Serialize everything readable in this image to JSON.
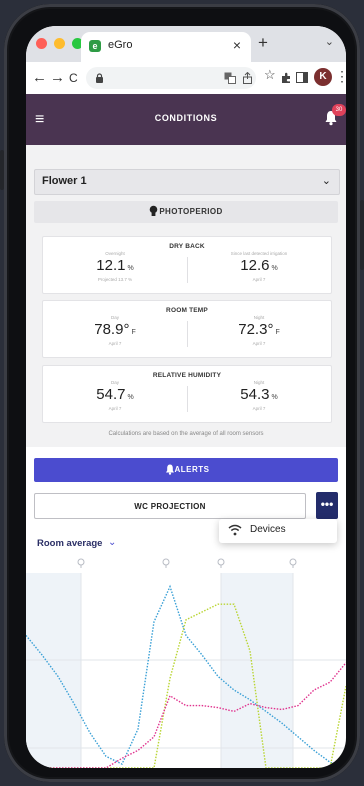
{
  "browser": {
    "tab_title": "eGro",
    "tab_favicon_letter": "e",
    "close_glyph": "×",
    "new_tab_glyph": "+",
    "tab_menu_glyph": "⌄",
    "back_glyph": "←",
    "forward_glyph": "→",
    "reload_glyph": "C",
    "profile_initial": "K",
    "menu_glyph": "⋮",
    "traffic_lights": [
      "#fe5f57",
      "#febc2e",
      "#28c840"
    ]
  },
  "header": {
    "title": "CONDITIONS",
    "menu_glyph": "≡",
    "notifications_count": "30",
    "color": "#4a3451"
  },
  "room_select": {
    "value": "Flower 1",
    "chevron": "⌄"
  },
  "photoperiod": {
    "label": "PHOTOPERIOD"
  },
  "cards": [
    {
      "title": "DRY BACK",
      "left": {
        "sub": "Overnight",
        "value": "12.1",
        "unit": "%",
        "note": "Projected 13.7 %"
      },
      "right": {
        "sub": "Since last detected irrigation",
        "value": "12.6",
        "unit": "%",
        "note": "April 7"
      }
    },
    {
      "title": "ROOM TEMP",
      "left": {
        "sub": "Day",
        "value": "78.9°",
        "unit": "F",
        "note": "April 7"
      },
      "right": {
        "sub": "Night",
        "value": "72.3°",
        "unit": "F",
        "note": "April 7"
      }
    },
    {
      "title": "RELATIVE HUMIDITY",
      "left": {
        "sub": "Day",
        "value": "54.7",
        "unit": "%",
        "note": "April 7"
      },
      "right": {
        "sub": "Night",
        "value": "54.3",
        "unit": "%",
        "note": "April 7"
      }
    }
  ],
  "footnote": "Calculations are based on the average of all room sensors",
  "alerts": {
    "label": "ALERTS",
    "color": "#4b4ccf"
  },
  "wc_projection": {
    "label": "WC PROJECTION",
    "more_glyph": "•••"
  },
  "menu": {
    "devices_label": "Devices"
  },
  "room_average": {
    "label": "Room average",
    "chevron": "⌄"
  },
  "chart_data": {
    "type": "line",
    "title": "",
    "xlabel": "",
    "ylabel": "",
    "x": [
      0,
      1,
      2,
      3,
      4,
      5,
      6,
      7,
      8,
      9,
      10,
      11,
      12,
      13,
      14,
      15,
      16,
      17,
      18,
      19,
      20
    ],
    "ylim": [
      0,
      100
    ],
    "grid": true,
    "series": [
      {
        "color": "#3aa0d6",
        "values": [
          68,
          58,
          47,
          33,
          18,
          6,
          2,
          20,
          75,
          93,
          68,
          58,
          47,
          40,
          35,
          29,
          23,
          16,
          9,
          3,
          0
        ]
      },
      {
        "color": "#b9d532",
        "values": [
          0,
          0,
          0,
          0,
          0,
          0,
          0,
          0,
          0,
          46,
          76,
          80,
          84,
          84,
          60,
          0,
          0,
          0,
          0,
          0,
          42
        ]
      },
      {
        "color": "#e0338e",
        "values": [
          0,
          0,
          0,
          0,
          0,
          0,
          5,
          9,
          16,
          37,
          32,
          32,
          31,
          29,
          33,
          31,
          30,
          32,
          40,
          44,
          54
        ]
      }
    ],
    "markers": [
      "bulb",
      "bulb",
      "bulb",
      "bulb"
    ]
  }
}
